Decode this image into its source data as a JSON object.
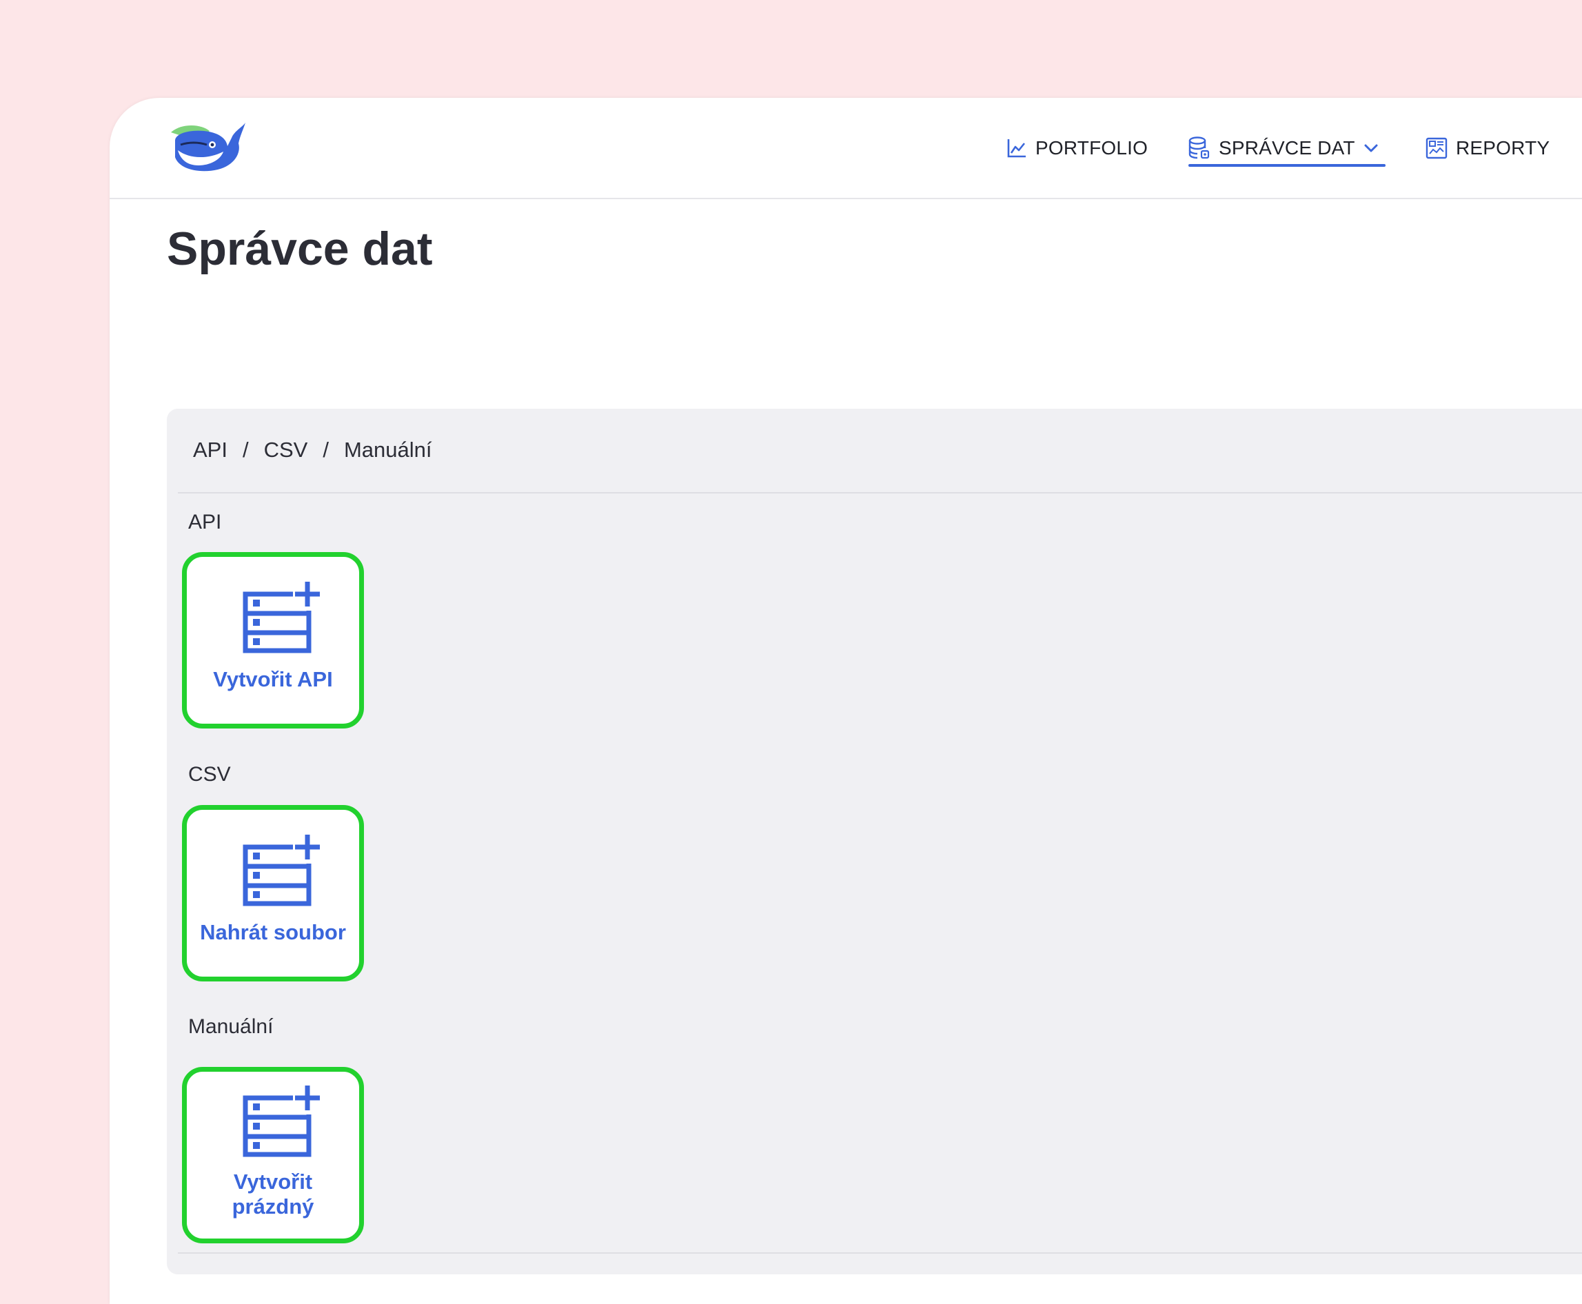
{
  "nav": {
    "items": [
      {
        "label": "PORTFOLIO",
        "icon": "line-chart-icon"
      },
      {
        "label": "SPRÁVCE DAT",
        "icon": "database-icon",
        "active": true,
        "dropdown": "chevron-down-icon"
      },
      {
        "label": "REPORTY",
        "icon": "report-icon"
      }
    ]
  },
  "page": {
    "title": "Správce dat"
  },
  "breadcrumb": {
    "items": [
      "API",
      "CSV",
      "Manuální"
    ],
    "separator": "/"
  },
  "sections": [
    {
      "label": "API",
      "tile_label": "Vytvořit API",
      "icon": "table-add-icon"
    },
    {
      "label": "CSV",
      "tile_label": "Nahrát soubor",
      "icon": "table-add-icon"
    },
    {
      "label": "Manuální",
      "tile_label_lines": [
        "Vytvořit",
        "prázdný"
      ],
      "icon": "table-add-icon"
    }
  ],
  "colors": {
    "accent": "#3a66db",
    "highlight": "#22d12e",
    "background": "#fde6e8",
    "panel": "#f0f0f3"
  }
}
